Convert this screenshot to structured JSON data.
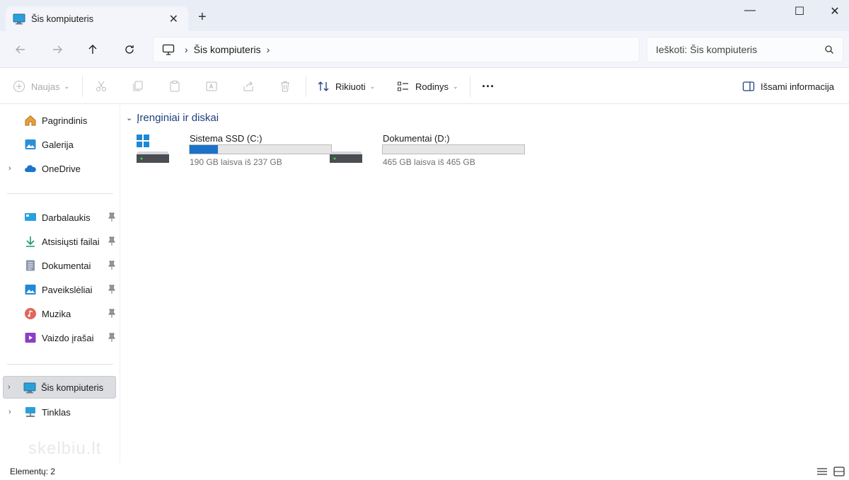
{
  "tab": {
    "title": "Šis kompiuteris",
    "close": "✕",
    "new_tab": "+"
  },
  "window_controls": {
    "minimize": "—",
    "maximize": "☐",
    "close": "✕"
  },
  "address": {
    "crumb": "Šis kompiuteris"
  },
  "search": {
    "placeholder": "Ieškoti: Šis kompiuteris"
  },
  "toolbar": {
    "new_label": "Naujas",
    "sort_label": "Rikiuoti",
    "view_label": "Rodinys",
    "more_label": "···",
    "details_label": "Išsami informacija"
  },
  "sidebar": {
    "items": [
      {
        "label": "Pagrindinis",
        "icon": "home-icon"
      },
      {
        "label": "Galerija",
        "icon": "gallery-icon"
      },
      {
        "label": "OneDrive",
        "icon": "cloud-icon"
      },
      {
        "label": "Darbalaukis",
        "icon": "desktop-icon"
      },
      {
        "label": "Atsisiųsti failai",
        "icon": "download-icon"
      },
      {
        "label": "Dokumentai",
        "icon": "document-icon"
      },
      {
        "label": "Paveikslėliai",
        "icon": "pictures-icon"
      },
      {
        "label": "Muzika",
        "icon": "music-icon"
      },
      {
        "label": "Vaizdo įrašai",
        "icon": "video-icon"
      },
      {
        "label": "Šis kompiuteris",
        "icon": "computer-icon"
      },
      {
        "label": "Tinklas",
        "icon": "network-icon"
      }
    ]
  },
  "content": {
    "group_title": "Įrenginiai ir diskai",
    "drives": [
      {
        "name": "Sistema SSD (C:)",
        "free_text": "190 GB laisva iš 237 GB",
        "used_fraction": 0.2
      },
      {
        "name": "Dokumentai (D:)",
        "free_text": "465 GB laisva iš 465 GB",
        "used_fraction": 0.0
      }
    ]
  },
  "watermark": "skelbiu.lt",
  "status": {
    "count_label": "Elementų: 2"
  },
  "colors": {
    "accent": "#1a73c9",
    "titlebar": "#e9edf5",
    "header_text": "#1f3f7a"
  }
}
